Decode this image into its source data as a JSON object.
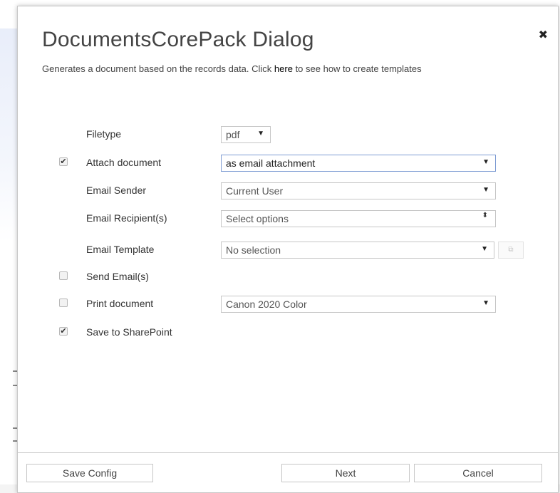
{
  "dialog": {
    "title": "DocumentsCorePack Dialog",
    "close_glyph": "✖",
    "subtitle_prefix": "Generates a document based on the records data. Click ",
    "subtitle_link": "here",
    "subtitle_suffix": " to see how to create templates"
  },
  "form": {
    "filetype": {
      "label": "Filetype",
      "value": "pdf"
    },
    "attach_document": {
      "label": "Attach document",
      "checked": true,
      "value": "as email attachment"
    },
    "email_sender": {
      "label": "Email Sender",
      "value": "Current User"
    },
    "email_recipients": {
      "label": "Email Recipient(s)",
      "placeholder": "Select options"
    },
    "email_template": {
      "label": "Email Template",
      "value": "No selection",
      "open_icon": "external-link-icon"
    },
    "send_emails": {
      "label": "Send Email(s)",
      "checked": false
    },
    "print_document": {
      "label": "Print document",
      "checked": false,
      "value": "Canon 2020 Color"
    },
    "save_to_sharepoint": {
      "label": "Save to SharePoint",
      "checked": true
    }
  },
  "glyphs": {
    "check": "✔",
    "dropdown": "▼",
    "updown": "⬍",
    "external": "⧉"
  },
  "footer": {
    "save_config": "Save Config",
    "next": "Next",
    "cancel": "Cancel"
  },
  "colors": {
    "focus_border": "#7d9bd3",
    "border": "#c6c6c6",
    "text": "#333333"
  }
}
